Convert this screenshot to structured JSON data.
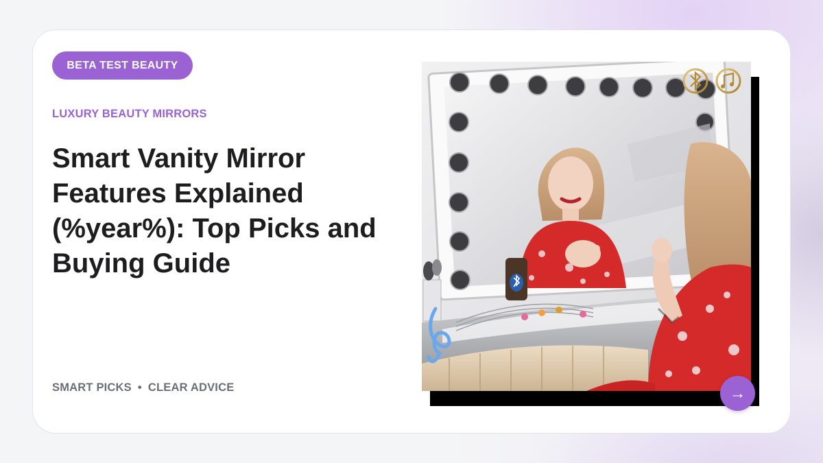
{
  "badge": {
    "label": "BETA TEST BEAUTY"
  },
  "category": {
    "label": "LUXURY BEAUTY MIRRORS"
  },
  "article": {
    "title": "Smart Vanity Mirror Features Explained (%year%): Top Picks and Buying Guide"
  },
  "footer": {
    "tag_1": "SMART PICKS",
    "separator": "•",
    "tag_2": "CLEAR ADVICE"
  },
  "next_button": {
    "glyph": "→",
    "icon": "arrow-right-icon"
  },
  "photo": {
    "icons": [
      "bluetooth-icon",
      "music-note-icon",
      "treble-clef-icon",
      "makeup-brushes-icon",
      "bluetooth-speaker-icon"
    ]
  },
  "colors": {
    "accent": "#9b62d4",
    "title": "#1d1d1f",
    "muted": "#6b6e75",
    "card": "#ffffff",
    "dress_red": "#d42a2a"
  }
}
